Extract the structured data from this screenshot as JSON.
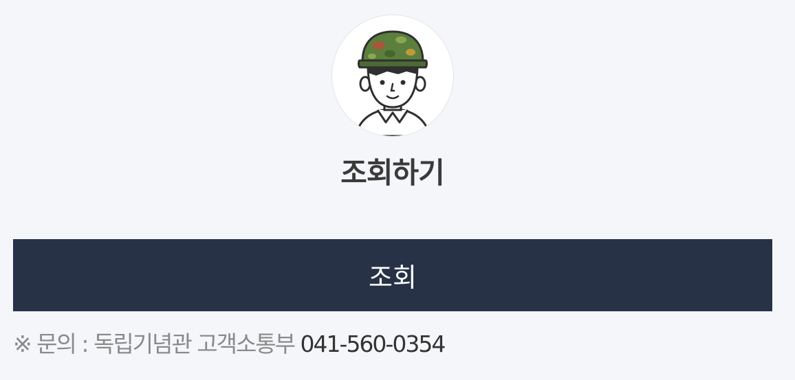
{
  "title": "조회하기",
  "submit_button": {
    "label": "조회"
  },
  "contact": {
    "prefix": "※ 문의 : 독립기념관 고객소통부 ",
    "phone": "041-560-0354"
  },
  "colors": {
    "background": "#f5f6fa",
    "button": "#273247",
    "title": "#3a3a3a",
    "helmet": "#5b7f3d"
  },
  "icons": {
    "avatar": "soldier-avatar-icon"
  }
}
